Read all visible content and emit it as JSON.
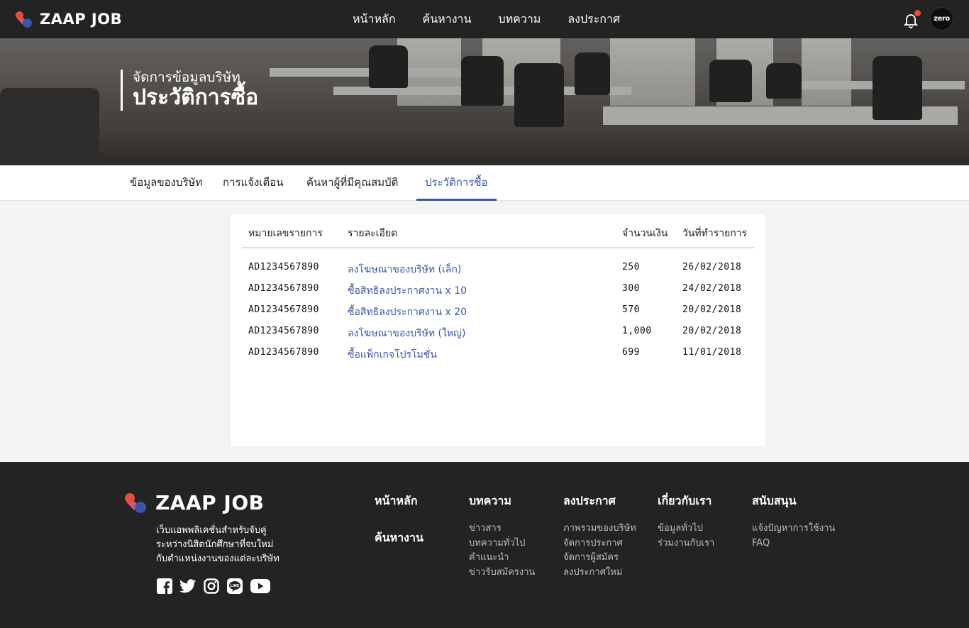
{
  "brand": {
    "name": "ZAAP JOB"
  },
  "nav": {
    "items": [
      "หน้าหลัก",
      "ค้นหางาน",
      "บทความ",
      "ลงประกาศ"
    ],
    "avatar_text": "zero"
  },
  "hero": {
    "subtitle": "จัดการข้อมูลบริษัท",
    "title": "ประวัติการซื้อ"
  },
  "tabs": [
    {
      "label": "ข้อมูลของบริษัท"
    },
    {
      "label": "การแจ้งเตือน"
    },
    {
      "label": "ค้นหาผู้ที่มีคุณสมบัติ"
    },
    {
      "label": "ประวัติการซื้อ",
      "active": true
    }
  ],
  "table": {
    "headers": [
      "หมายเลขรายการ",
      "รายละเอียด",
      "จำนวนเงิน",
      "วันที่ทำรายการ"
    ],
    "rows": [
      [
        "AD1234567890",
        "ลงโฆษณาของบริษัท (เล็ก)",
        "250",
        "26/02/2018"
      ],
      [
        "AD1234567890",
        "ซื้อสิทธิลงประกาศงาน x 10",
        "300",
        "24/02/2018"
      ],
      [
        "AD1234567890",
        "ซื้อสิทธิลงประกาศงาน x 20",
        "570",
        "20/02/2018"
      ],
      [
        "AD1234567890",
        "ลงโฆษณาของบริษัท (ใหญ่)",
        "1,000",
        "20/02/2018"
      ],
      [
        "AD1234567890",
        "ซื้อแพ็กเกจโปรโมชั่น",
        "699",
        "11/01/2018"
      ]
    ]
  },
  "footer": {
    "tagline": [
      "เว็บแอพพลิเคชั่นสำหรับจับคู่",
      "ระหว่างนิสิตนักศึกษาที่จบใหม่",
      "กับตำแหน่งงานของแต่ละบริษัท"
    ],
    "social_icons": [
      "facebook-icon",
      "twitter-icon",
      "instagram-icon",
      "line-icon",
      "youtube-icon"
    ],
    "home": "หน้าหลัก",
    "search": "ค้นหางาน",
    "columns": [
      {
        "title": "บทความ",
        "links": [
          "ข่าวสาร",
          "บทความทั่วไป",
          "คำแนะนำ",
          "ข่าวรับสมัครงาน"
        ]
      },
      {
        "title": "ลงประกาศ",
        "links": [
          "ภาพรวมของบริษัท",
          "จัดการประกาศ",
          "จัดการผู้สมัคร",
          "ลงประกาศใหม่"
        ]
      },
      {
        "title": "เกี่ยวกับเรา",
        "links": [
          "ข้อมูลทั่วไป",
          "ร่วมงานกับเรา"
        ]
      },
      {
        "title": "สนับสนุน",
        "links": [
          "แจ้งปัญหาการใช้งาน",
          "FAQ"
        ]
      }
    ]
  },
  "colors": {
    "accent": "#3a57a5",
    "dark": "#232323",
    "notify": "#e94c3d"
  }
}
